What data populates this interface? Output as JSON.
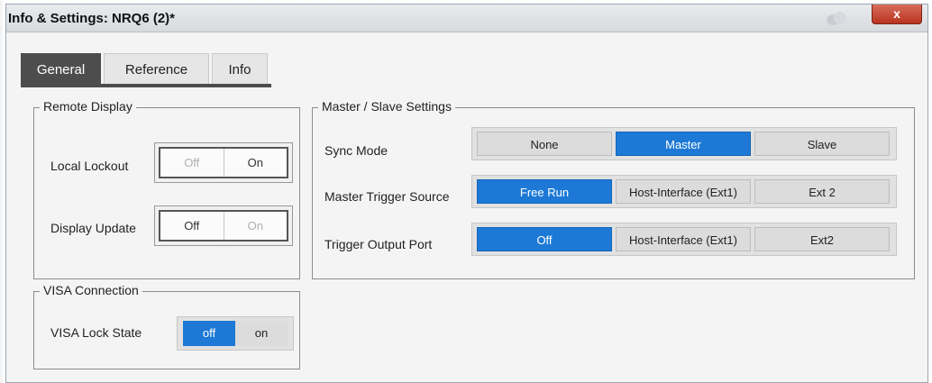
{
  "window": {
    "title": "Info & Settings: NRQ6 (2)*",
    "close_label": "x"
  },
  "tabs": [
    {
      "label": "General",
      "active": true
    },
    {
      "label": "Reference",
      "active": false
    },
    {
      "label": "Info",
      "active": false
    }
  ],
  "remote_display": {
    "group_label": "Remote Display",
    "local_lockout": {
      "label": "Local Lockout",
      "off": "Off",
      "on": "On",
      "selected": "On"
    },
    "display_update": {
      "label": "Display Update",
      "off": "Off",
      "on": "On",
      "selected": "Off"
    }
  },
  "visa": {
    "group_label": "VISA Connection",
    "lock_state": {
      "label": "VISA Lock State",
      "off": "off",
      "on": "on",
      "selected": "off"
    }
  },
  "master_slave": {
    "group_label": "Master / Slave Settings",
    "sync_mode": {
      "label": "Sync Mode",
      "options": [
        "None",
        "Master",
        "Slave"
      ],
      "selected": "Master"
    },
    "trigger_source": {
      "label": "Master Trigger Source",
      "options": [
        "Free Run",
        "Host-Interface (Ext1)",
        "Ext 2"
      ],
      "selected": "Free Run"
    },
    "output_port": {
      "label": "Trigger Output Port",
      "options": [
        "Off",
        "Host-Interface (Ext1)",
        "Ext2"
      ],
      "selected": "Off"
    }
  },
  "colors": {
    "accent": "#1d79d5",
    "tab_active": "#4d4d4d",
    "close": "#c0432f"
  }
}
